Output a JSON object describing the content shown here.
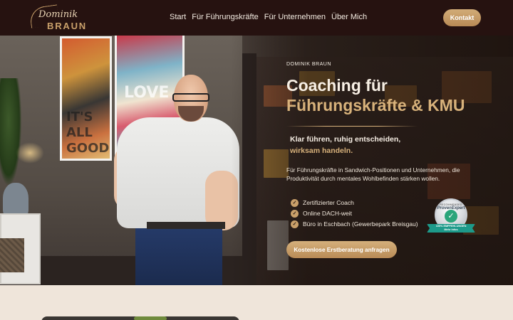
{
  "header": {
    "logo_script": "Dominik",
    "logo_name": "BRAUN",
    "nav": [
      {
        "label": "Start"
      },
      {
        "label": "Für Führungskräfte"
      },
      {
        "label": "Für Unternehmen"
      },
      {
        "label": "Über Mich"
      }
    ],
    "cta_label": "Kontakt"
  },
  "hero": {
    "background_art": {
      "art_1_text": "IT'S\nALL\nGOOD",
      "art_2_text": "LOVE"
    },
    "eyebrow": "DOMINIK BRAUN",
    "title_line1": "Coaching für",
    "title_line2": "Führungskräfte & KMU",
    "subtitle_line1": "Klar führen, ruhig entscheiden,",
    "subtitle_line2": "wirksam handeln.",
    "body": "Für Führungskräfte in Sandwich-Positionen und Unternehmen, die Produktivität durch mentales Wohlbefinden stärken wollen.",
    "checks": [
      {
        "text": "Zertifizierter Coach"
      },
      {
        "text": "Online DACH-weit"
      },
      {
        "text": "Büro in Eschbach (Gewerbepark Breisgau)"
      }
    ],
    "cta_label": "Kostenlose Erstberatung anfragen",
    "seal": {
      "top_text": "RECOMMENDED",
      "brand": "ProvenExpert",
      "ribbon_line1": "100% EMPFEHLUNGEN",
      "ribbon_line2": "Mehr Infos"
    }
  },
  "colors": {
    "header_bg": "#261210",
    "accent_gold": "#d8b27b",
    "button_gold": "#c9a06a",
    "page_bg": "#efe5da"
  },
  "icons": {
    "check": "check-circle-icon",
    "seal": "provenexpert-seal-icon"
  }
}
